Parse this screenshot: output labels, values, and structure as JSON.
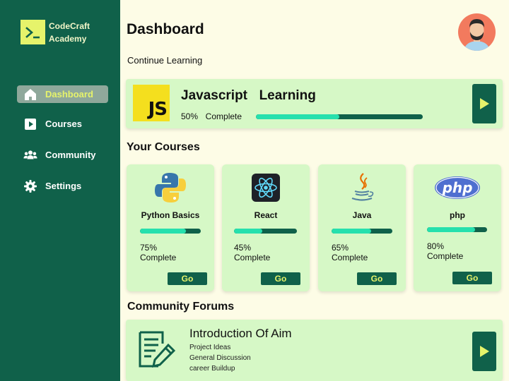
{
  "brand": {
    "name": "CodeCraft Academy",
    "logo_icon": "terminal-prompt-icon"
  },
  "sidebar": {
    "items": [
      {
        "label": "Dashboard",
        "icon": "home-icon",
        "active": true
      },
      {
        "label": "Courses",
        "icon": "play-square-icon",
        "active": false
      },
      {
        "label": "Community",
        "icon": "users-icon",
        "active": false
      },
      {
        "label": "Settings",
        "icon": "gear-icon",
        "active": false
      }
    ]
  },
  "header": {
    "title": "Dashboard",
    "avatar_icon": "user-avatar-icon"
  },
  "continue": {
    "subtitle": "Continue Learning",
    "course_title": "Javascript  Learning",
    "logo_text": "JS",
    "progress_text": "50%  Complete",
    "progress": 0.5
  },
  "courses": {
    "title": "Your Courses",
    "items": [
      {
        "name": "Python Basics",
        "percent": "75%",
        "complete_label": "Complete",
        "progress": 0.75,
        "button": "Go",
        "icon": "python-logo-icon"
      },
      {
        "name": "React",
        "percent": "45%",
        "complete_label": "Complete",
        "progress": 0.45,
        "button": "Go",
        "icon": "react-logo-icon"
      },
      {
        "name": "Java",
        "percent": "65%",
        "complete_label": "Complete",
        "progress": 0.65,
        "button": "Go",
        "icon": "java-logo-icon"
      },
      {
        "name": "php",
        "percent": "80%",
        "complete_label": "Complete",
        "progress": 0.8,
        "button": "Go",
        "icon": "php-logo-icon"
      }
    ]
  },
  "forums": {
    "title": "Community Forums",
    "card_title": "Introduction Of Aim",
    "items": [
      "Project Ideas",
      "General Discussion",
      "career Buildup"
    ],
    "icon": "document-edit-icon"
  },
  "colors": {
    "sidebar_bg": "#10614a",
    "accent_yellow": "#e6f36b",
    "card_bg": "#d6f8c6",
    "progress_fill": "#26e0ad",
    "page_bg": "#fdfce6"
  }
}
